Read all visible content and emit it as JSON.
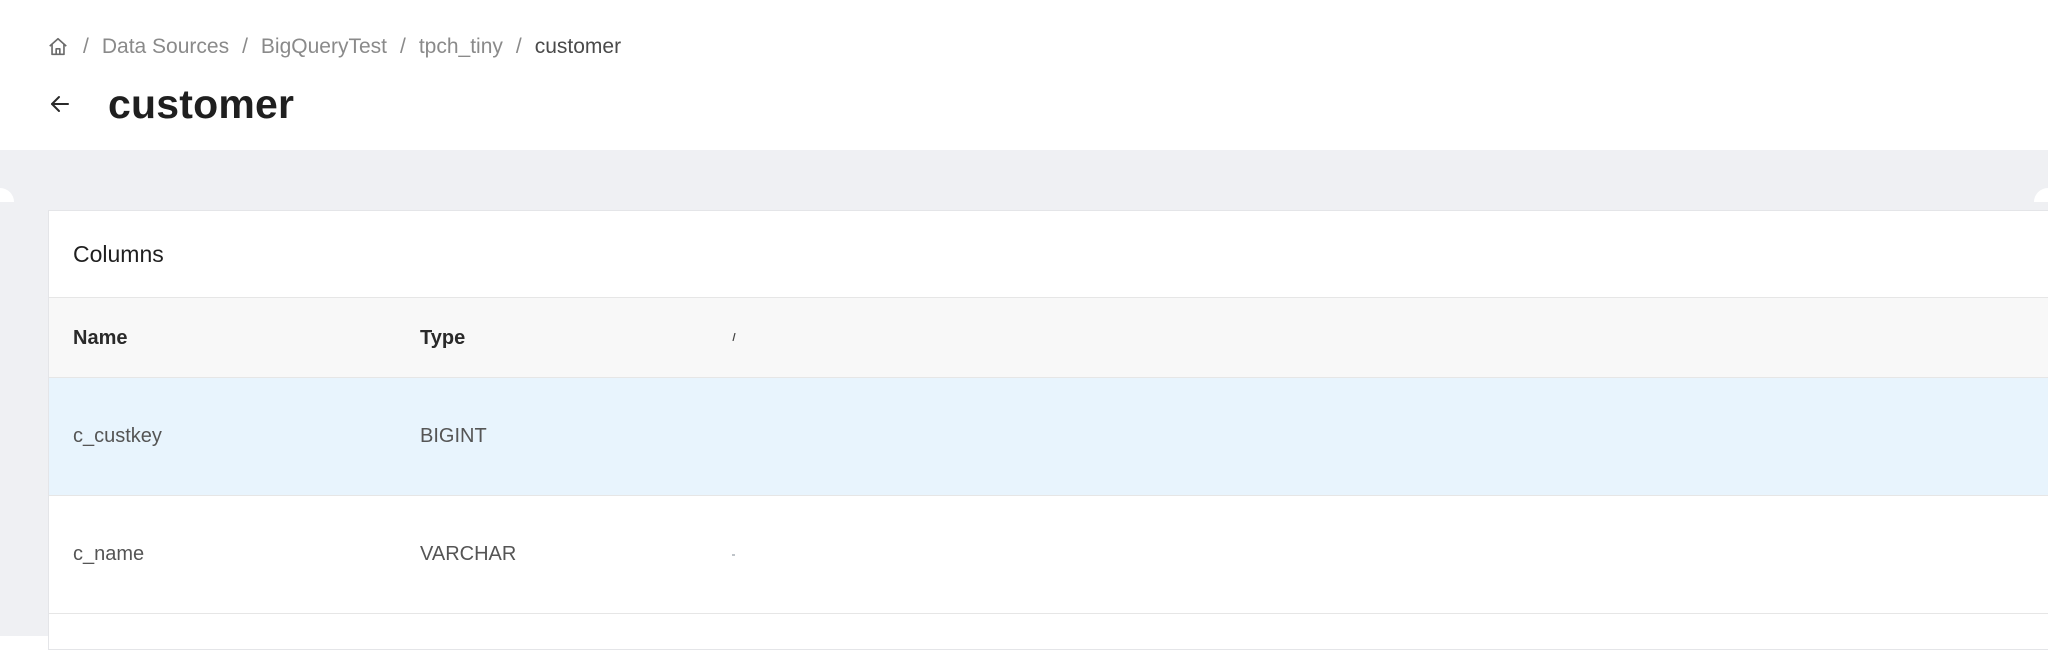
{
  "breadcrumb": {
    "items": [
      "Data Sources",
      "BigQueryTest",
      "tpch_tiny"
    ],
    "current": "customer",
    "separator": "/"
  },
  "page": {
    "title": "customer"
  },
  "columns_card": {
    "title": "Columns",
    "headers": {
      "name": "Name",
      "type": "Type"
    },
    "rows": [
      {
        "name": "c_custkey",
        "type": "BIGINT"
      },
      {
        "name": "c_name",
        "type": "VARCHAR"
      }
    ]
  },
  "colors": {
    "page_background": "#eff0f3",
    "selected_row": "#e8f4fd",
    "header_row": "#f8f8f8"
  },
  "icons": {
    "home": "home-icon",
    "back": "arrow-left-icon"
  }
}
